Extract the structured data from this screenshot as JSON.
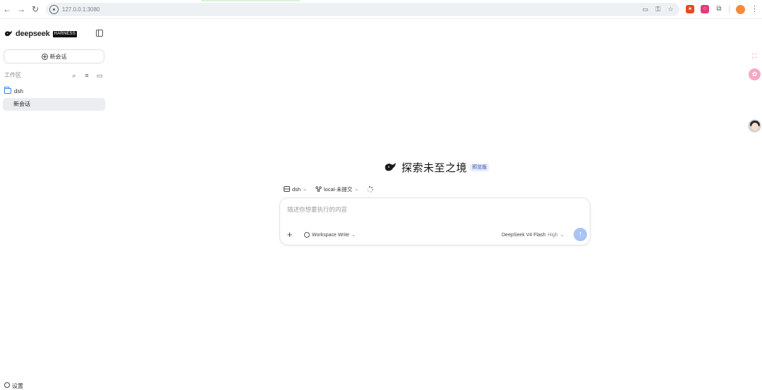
{
  "browser": {
    "url": "127.0.0.1:3080",
    "icons": {
      "back": "arrow-left-icon",
      "forward": "arrow-right-icon",
      "reload": "reload-icon",
      "site_info": "site-info-icon",
      "cast": "cast-icon",
      "password": "key-icon",
      "bookmark": "star-icon",
      "extension_1": "bug-extension-icon",
      "extension_2": "dice-extension-icon",
      "extensions": "puzzle-icon",
      "profile": "profile-icon",
      "menu": "more-vert-icon"
    },
    "colors": {
      "omnibox_bg": "#eef1f4",
      "extension_1": "#e8491d",
      "extension_2": "#e23b78",
      "profile": "#f28b3c"
    }
  },
  "sidebar": {
    "brand_name": "deepseek",
    "brand_badge": "HARNESS",
    "new_chat_label": "新会话",
    "workspace_title": "工作区",
    "folder_label": "dsh",
    "active_chat_label": "新会话",
    "settings_label": "设置"
  },
  "main": {
    "hero_title": "探索未至之境",
    "hero_tag": "预览版",
    "context": {
      "workspace_label": "dsh",
      "branch_label": "local-未提交"
    },
    "composer": {
      "placeholder": "描述你想要执行的内容",
      "mode_label": "Workspace Write",
      "model_label": "DeepSeek V4 Flash",
      "effort_label": "High"
    },
    "accent_color": "#a9c3f5"
  },
  "floating": {
    "scan_icon": "scan-icon",
    "assistant_icon": "pink-assistant-icon",
    "avatar_icon": "user-avatar"
  }
}
